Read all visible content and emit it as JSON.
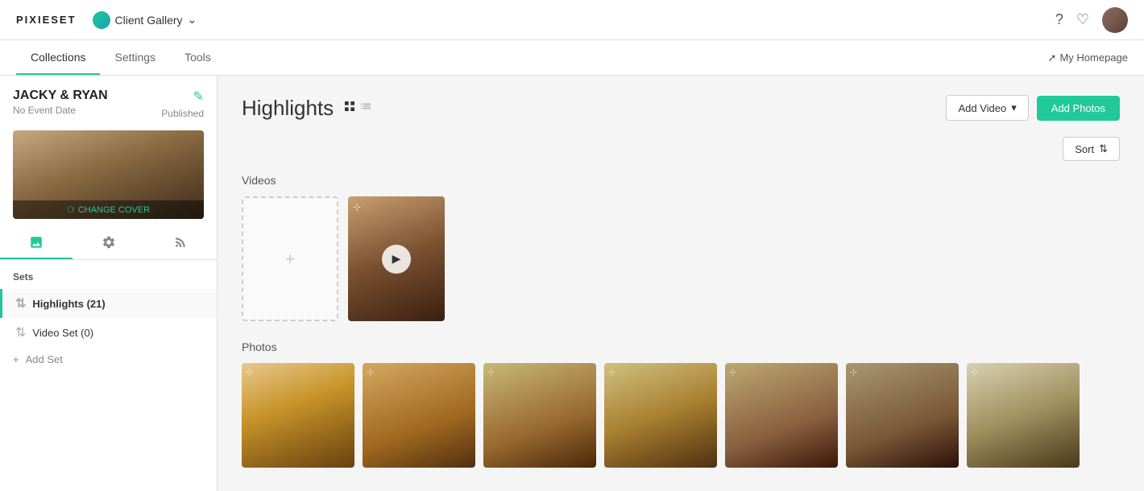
{
  "app": {
    "logo": "PIXIESET",
    "gallery_name": "Client Gallery",
    "my_homepage_label": "My Homepage"
  },
  "top_nav": {
    "tabs": [
      {
        "id": "collections",
        "label": "Collections",
        "active": true
      },
      {
        "id": "settings",
        "label": "Settings",
        "active": false
      },
      {
        "id": "tools",
        "label": "Tools",
        "active": false
      }
    ]
  },
  "sidebar": {
    "client_name": "JACKY & RYAN",
    "event_date": "No Event Date",
    "status": "Published",
    "change_cover_label": "CHANGE COVER",
    "sets_label": "Sets",
    "items": [
      {
        "id": "highlights",
        "label": "Highlights (21)",
        "active": true
      },
      {
        "id": "video-set",
        "label": "Video Set (0)",
        "active": false
      }
    ],
    "add_set_label": "Add Set"
  },
  "content": {
    "title": "Highlights",
    "add_video_label": "Add Video",
    "add_photos_label": "Add Photos",
    "sort_label": "Sort",
    "videos_section_label": "Videos",
    "photos_section_label": "Photos"
  }
}
